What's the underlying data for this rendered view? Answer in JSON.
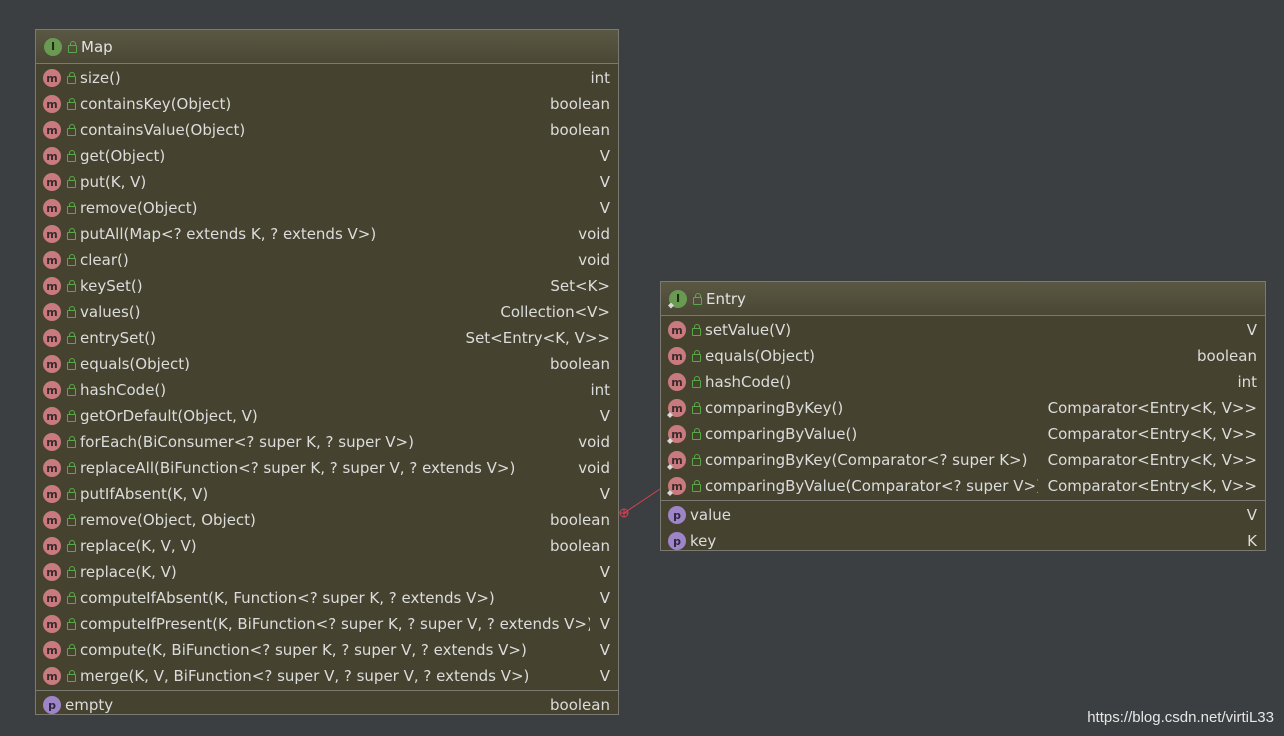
{
  "map": {
    "title": "Map",
    "methods": [
      {
        "name": "size()",
        "type": "int"
      },
      {
        "name": "containsKey(Object)",
        "type": "boolean"
      },
      {
        "name": "containsValue(Object)",
        "type": "boolean"
      },
      {
        "name": "get(Object)",
        "type": "V"
      },
      {
        "name": "put(K, V)",
        "type": "V"
      },
      {
        "name": "remove(Object)",
        "type": "V"
      },
      {
        "name": "putAll(Map<? extends K, ? extends V>)",
        "type": "void"
      },
      {
        "name": "clear()",
        "type": "void"
      },
      {
        "name": "keySet()",
        "type": "Set<K>"
      },
      {
        "name": "values()",
        "type": "Collection<V>"
      },
      {
        "name": "entrySet()",
        "type": "Set<Entry<K, V>>"
      },
      {
        "name": "equals(Object)",
        "type": "boolean"
      },
      {
        "name": "hashCode()",
        "type": "int"
      },
      {
        "name": "getOrDefault(Object, V)",
        "type": "V"
      },
      {
        "name": "forEach(BiConsumer<? super K, ? super V>)",
        "type": "void"
      },
      {
        "name": "replaceAll(BiFunction<? super K, ? super V, ? extends V>)",
        "type": "void"
      },
      {
        "name": "putIfAbsent(K, V)",
        "type": "V"
      },
      {
        "name": "remove(Object, Object)",
        "type": "boolean"
      },
      {
        "name": "replace(K, V, V)",
        "type": "boolean"
      },
      {
        "name": "replace(K, V)",
        "type": "V"
      },
      {
        "name": "computeIfAbsent(K, Function<? super K, ? extends V>)",
        "type": "V"
      },
      {
        "name": "computeIfPresent(K, BiFunction<? super K, ? super V, ? extends V>)",
        "type": "V"
      },
      {
        "name": "compute(K, BiFunction<? super K, ? super V, ? extends V>)",
        "type": "V"
      },
      {
        "name": "merge(K, V, BiFunction<? super V, ? super V, ? extends V>)",
        "type": "V"
      }
    ],
    "properties": [
      {
        "name": "empty",
        "type": "boolean"
      }
    ]
  },
  "entry": {
    "title": "Entry",
    "methods": [
      {
        "name": "setValue(V)",
        "type": "V",
        "static": false
      },
      {
        "name": "equals(Object)",
        "type": "boolean",
        "static": false
      },
      {
        "name": "hashCode()",
        "type": "int",
        "static": false
      },
      {
        "name": "comparingByKey()",
        "type": "Comparator<Entry<K, V>>",
        "static": true
      },
      {
        "name": "comparingByValue()",
        "type": "Comparator<Entry<K, V>>",
        "static": true
      },
      {
        "name": "comparingByKey(Comparator<? super K>)",
        "type": "Comparator<Entry<K, V>>",
        "static": true
      },
      {
        "name": "comparingByValue(Comparator<? super V>)",
        "type": "Comparator<Entry<K, V>>",
        "static": true
      }
    ],
    "properties": [
      {
        "name": "value",
        "type": "V"
      },
      {
        "name": "key",
        "type": "K"
      }
    ]
  },
  "badges": {
    "interface": "I",
    "method": "m",
    "property": "p"
  },
  "colors": {
    "background": "#3c3f41",
    "box": "#45432f",
    "method_badge": "#c97a7e",
    "property_badge": "#9e85c8",
    "interface_badge": "#6a9a52",
    "connector": "#d84050"
  },
  "watermark": "https://blog.csdn.net/virtiL33"
}
